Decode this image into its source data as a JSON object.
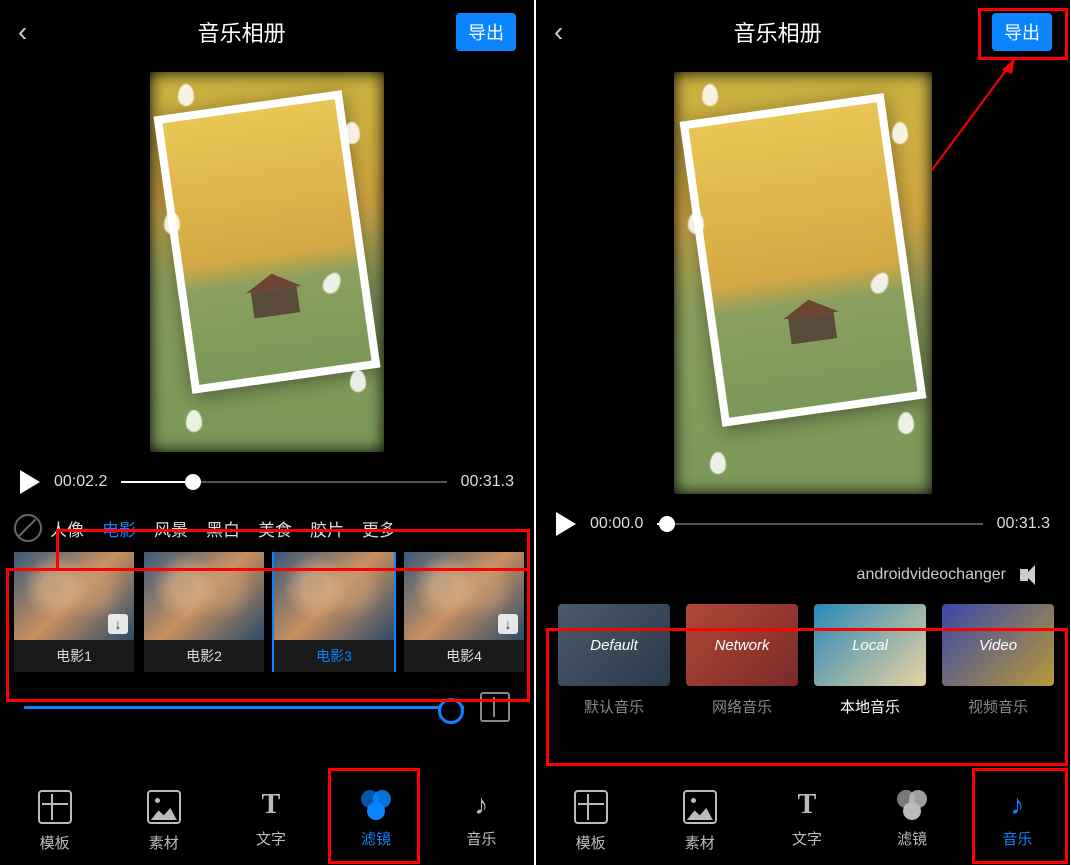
{
  "left": {
    "title": "音乐相册",
    "export": "导出",
    "time_current": "00:02.2",
    "time_total": "00:31.3",
    "seek_percent": 22,
    "categories": [
      "人像",
      "电影",
      "风景",
      "黑白",
      "美食",
      "胶片",
      "更多"
    ],
    "active_category": 1,
    "filters": [
      {
        "label": "电影1",
        "download": true
      },
      {
        "label": "电影2",
        "download": false
      },
      {
        "label": "电影3",
        "download": false
      },
      {
        "label": "电影4",
        "download": true
      }
    ],
    "selected_filter": 2,
    "nav": [
      {
        "label": "模板",
        "icon": "template"
      },
      {
        "label": "素材",
        "icon": "material"
      },
      {
        "label": "文字",
        "icon": "text"
      },
      {
        "label": "滤镜",
        "icon": "filter"
      },
      {
        "label": "音乐",
        "icon": "music"
      }
    ],
    "active_nav": 3
  },
  "right": {
    "title": "音乐相册",
    "export": "导出",
    "time_current": "00:00.0",
    "time_total": "00:31.3",
    "seek_percent": 3,
    "track_name": "androidvideochanger",
    "music_options": [
      {
        "title": "Default",
        "sub": "默认音乐"
      },
      {
        "title": "Network",
        "sub": "网络音乐"
      },
      {
        "title": "Local",
        "sub": "本地音乐"
      },
      {
        "title": "Video",
        "sub": "视频音乐"
      }
    ],
    "active_music": 2,
    "nav": [
      {
        "label": "模板",
        "icon": "template"
      },
      {
        "label": "素材",
        "icon": "material"
      },
      {
        "label": "文字",
        "icon": "text"
      },
      {
        "label": "滤镜",
        "icon": "filter"
      },
      {
        "label": "音乐",
        "icon": "music"
      }
    ],
    "active_nav": 4
  },
  "text_T": "T"
}
